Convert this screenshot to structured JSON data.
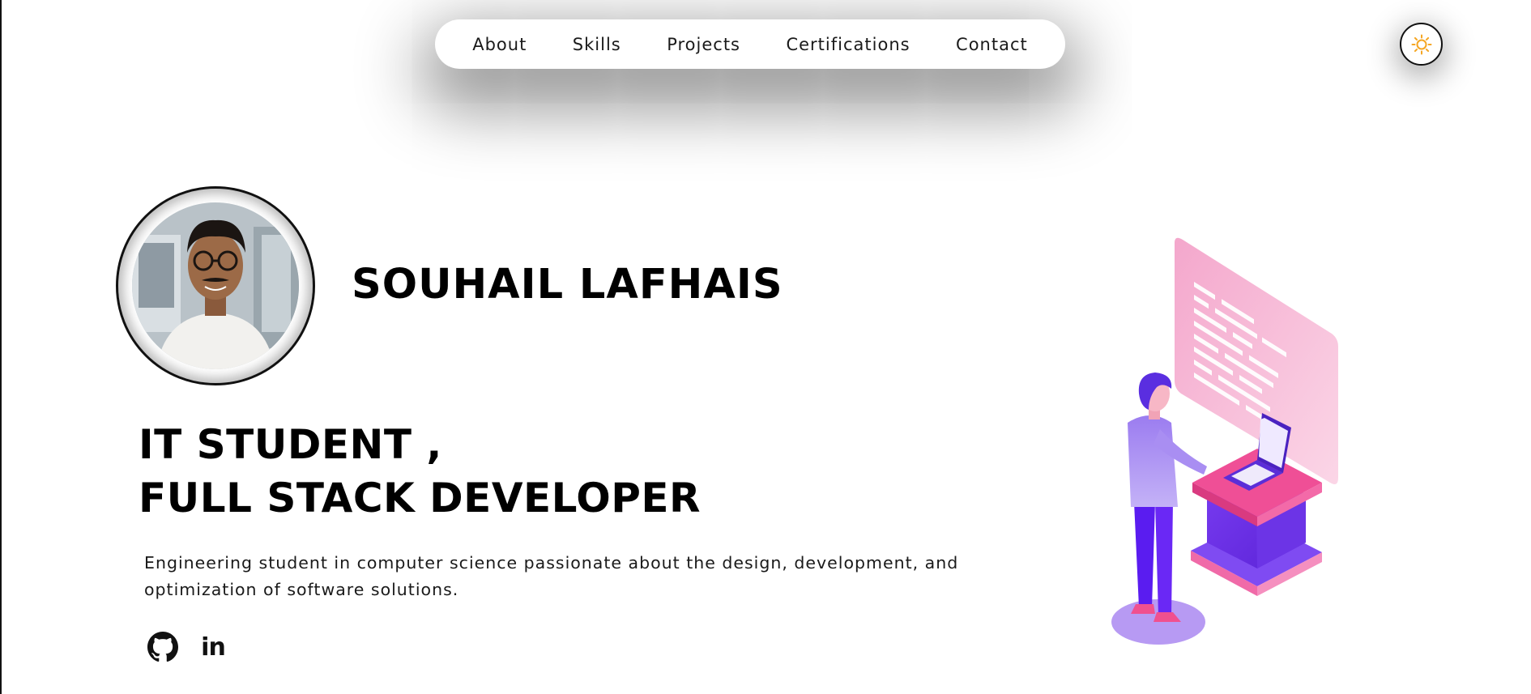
{
  "nav": {
    "items": [
      {
        "label": "About"
      },
      {
        "label": "Skills"
      },
      {
        "label": "Projects"
      },
      {
        "label": "Certifications"
      },
      {
        "label": "Contact"
      }
    ]
  },
  "theme_toggle": {
    "icon": "sun-icon",
    "color": "#f5a623"
  },
  "hero": {
    "name": "SOUHAIL LAFHAIS",
    "headline_line1": "IT STUDENT ,",
    "headline_line2": "FULL STACK DEVELOPER",
    "bio": "Engineering student in computer science passionate about the design, development, and optimization of software solutions."
  },
  "socials": {
    "github": {
      "icon": "github-icon"
    },
    "linkedin": {
      "icon": "linkedin-icon",
      "text": "in"
    }
  },
  "colors": {
    "accent_purple": "#6a2cf5",
    "accent_pink": "#f2579a"
  }
}
